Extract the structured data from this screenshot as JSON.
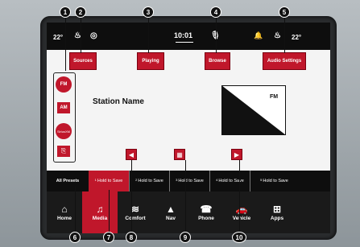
{
  "status_bar": {
    "temp_left": "22°",
    "clock": "10:01",
    "temp_right": "22°",
    "icons": [
      "seat-heat-icon",
      "steering-heat-icon",
      "mic-icon",
      "bell-icon",
      "seat-cool-icon"
    ]
  },
  "top_buttons": {
    "sources": "Sources",
    "playing": "Playing",
    "browse": "Browse",
    "audio_settings": "Audio Settings"
  },
  "sources_list": {
    "fm": "FM",
    "am": "AM",
    "siriusxm": "SiriusXM",
    "usb_icon": "usb-icon"
  },
  "now_playing": {
    "station_name": "Station Name",
    "album_band": "FM"
  },
  "controls": {
    "prev_icon": "previous-icon",
    "grid_icon": "grid-icon",
    "next_icon": "next-icon"
  },
  "presets": {
    "all": "All Presets",
    "items": [
      {
        "num": "1",
        "label": "Hold to Save"
      },
      {
        "num": "2",
        "label": "Hold to Save"
      },
      {
        "num": "3",
        "label": "Hold to Save"
      },
      {
        "num": "4",
        "label": "Hold to Save"
      },
      {
        "num": "5",
        "label": "Hold to Save"
      }
    ]
  },
  "nav": {
    "home": "Home",
    "media": "Media",
    "comfort": "Comfort",
    "nav": "Nav",
    "phone": "Phone",
    "vehicle": "Vehicle",
    "apps": "Apps"
  },
  "callouts": [
    "1",
    "2",
    "3",
    "4",
    "5",
    "6",
    "7",
    "8",
    "9",
    "10"
  ],
  "colors": {
    "accent": "#c0172b",
    "bar": "#0e0e0e",
    "screen": "#f4f4f4"
  }
}
